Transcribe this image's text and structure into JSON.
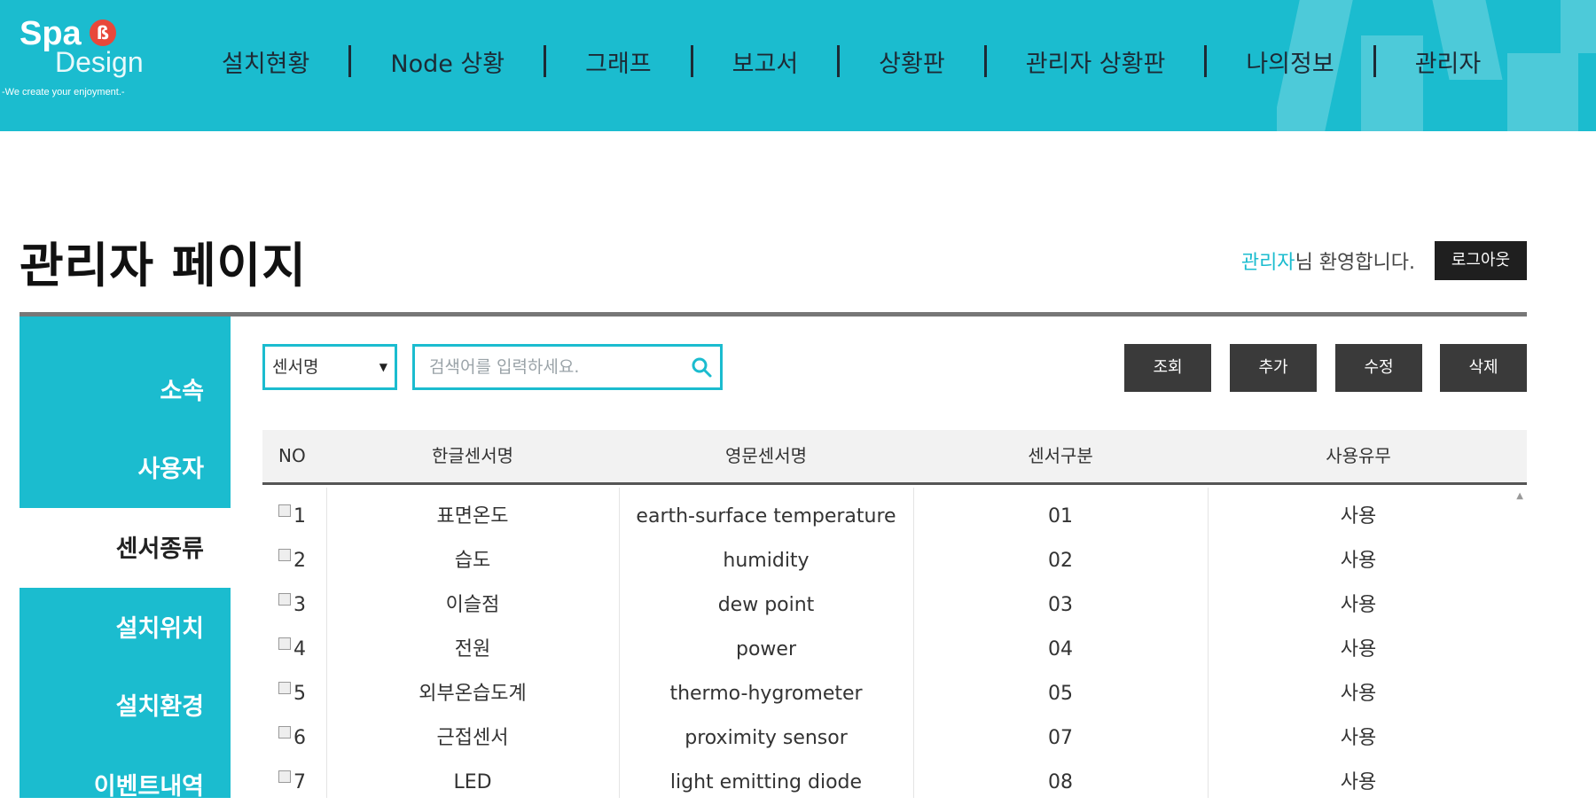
{
  "header": {
    "logo": {
      "word1": "Spa",
      "mark": "ß",
      "word2": "Design",
      "tagline": "-We create your enjoyment.-"
    },
    "nav": [
      {
        "label": "설치현황"
      },
      {
        "label": "Node 상황"
      },
      {
        "label": "그래프"
      },
      {
        "label": "보고서"
      },
      {
        "label": "상황판"
      },
      {
        "label": "관리자 상황판"
      },
      {
        "label": "나의정보"
      },
      {
        "label": "관리자"
      }
    ],
    "accent_color": "#1bbccf"
  },
  "page": {
    "title": "관리자 페이지",
    "welcome_name": "관리자",
    "welcome_suffix": "님 환영합니다.",
    "logout_label": "로그아웃"
  },
  "sidebar": {
    "items": [
      {
        "label": "소속",
        "active": false
      },
      {
        "label": "사용자",
        "active": false
      },
      {
        "label": "센서종류",
        "active": true
      },
      {
        "label": "설치위치",
        "active": false
      },
      {
        "label": "설치환경",
        "active": false
      },
      {
        "label": "이벤트내역",
        "active": false
      }
    ]
  },
  "toolbar": {
    "category_selected": "센서명",
    "search_placeholder": "검색어를 입력하세요.",
    "search_value": "",
    "buttons": {
      "query": "조회",
      "add": "추가",
      "edit": "수정",
      "delete": "삭제"
    }
  },
  "table": {
    "columns": {
      "no": "NO",
      "korean_name": "한글센서명",
      "english_name": "영문센서명",
      "category": "센서구분",
      "in_use": "사용유무"
    },
    "rows": [
      {
        "no": "1",
        "korean_name": "표면온도",
        "english_name": "earth-surface temperature",
        "category": "01",
        "in_use": "사용"
      },
      {
        "no": "2",
        "korean_name": "습도",
        "english_name": "humidity",
        "category": "02",
        "in_use": "사용"
      },
      {
        "no": "3",
        "korean_name": "이슬점",
        "english_name": "dew point",
        "category": "03",
        "in_use": "사용"
      },
      {
        "no": "4",
        "korean_name": "전원",
        "english_name": "power",
        "category": "04",
        "in_use": "사용"
      },
      {
        "no": "5",
        "korean_name": "외부온습도계",
        "english_name": "thermo-hygrometer",
        "category": "05",
        "in_use": "사용"
      },
      {
        "no": "6",
        "korean_name": "근접센서",
        "english_name": "proximity sensor",
        "category": "07",
        "in_use": "사용"
      },
      {
        "no": "7",
        "korean_name": "LED",
        "english_name": "light emitting diode",
        "category": "08",
        "in_use": "사용"
      }
    ]
  }
}
